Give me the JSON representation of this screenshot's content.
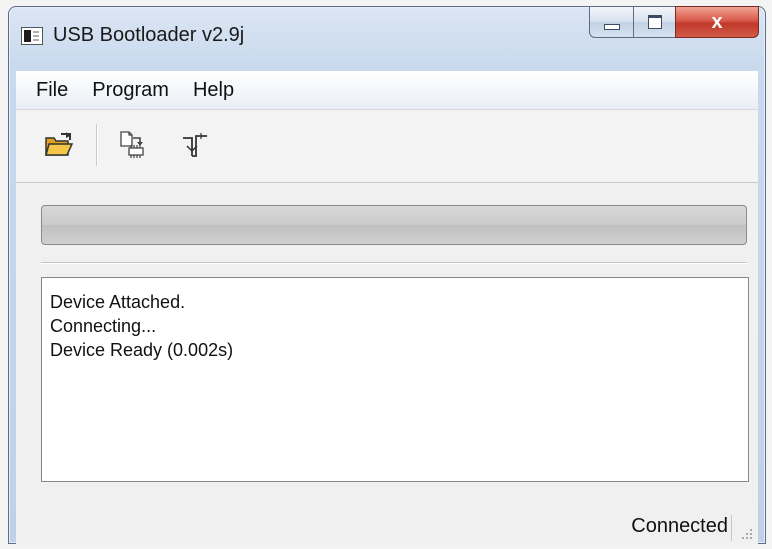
{
  "window": {
    "title": "USB Bootloader v2.9j"
  },
  "title_buttons": {
    "minimize_icon": "minimize-icon",
    "maximize_icon": "maximize-icon",
    "close_glyph": "x",
    "close_color": "#c0392b"
  },
  "menu": {
    "items": [
      {
        "label": "File"
      },
      {
        "label": "Program"
      },
      {
        "label": "Help"
      }
    ]
  },
  "toolbar": {
    "icons": [
      "open-folder-icon",
      "write-device-icon",
      "reset-device-icon"
    ]
  },
  "progress": {
    "value": 0
  },
  "log": {
    "lines": [
      "Device Attached.",
      "Connecting...",
      "Device Ready (0.002s)"
    ]
  },
  "status": {
    "text": "Connected"
  }
}
